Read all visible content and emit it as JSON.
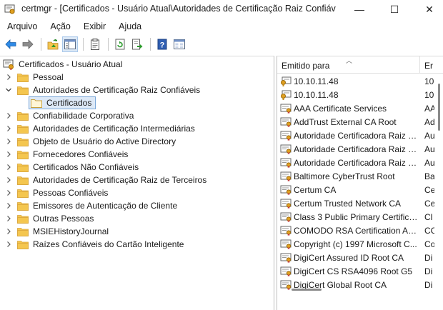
{
  "window": {
    "title": "certmgr - [Certificados - Usuário Atual\\Autoridades de Certificação Raiz Confiáveis\\C...",
    "min_glyph": "—",
    "max_glyph": "☐",
    "close_glyph": "✕"
  },
  "menu": [
    "Arquivo",
    "Ação",
    "Exibir",
    "Ajuda"
  ],
  "toolbar": {
    "icons": [
      "back-arrow-icon",
      "forward-arrow-icon",
      "up-folder-icon",
      "show-hide-tree-icon",
      "properties-icon",
      "refresh-icon",
      "export-list-icon",
      "help-icon",
      "help-topics-icon"
    ]
  },
  "tree": {
    "root": "Certificados - Usuário Atual",
    "items": [
      {
        "label": "Pessoal",
        "expanded": false
      },
      {
        "label": "Autoridades de Certificação Raiz Confiáveis",
        "expanded": true
      },
      {
        "label": "Confiabilidade Corporativa",
        "expanded": false
      },
      {
        "label": "Autoridades de Certificação Intermediárias",
        "expanded": false
      },
      {
        "label": "Objeto de Usuário do Active Directory",
        "expanded": false
      },
      {
        "label": "Fornecedores Confiáveis",
        "expanded": false
      },
      {
        "label": "Certificados Não Confiáveis",
        "expanded": false
      },
      {
        "label": "Autoridades de Certificação Raiz de Terceiros",
        "expanded": false
      },
      {
        "label": "Pessoas Confiáveis",
        "expanded": false
      },
      {
        "label": "Emissores de Autenticação de Cliente",
        "expanded": false
      },
      {
        "label": "Outras Pessoas",
        "expanded": false
      },
      {
        "label": "MSIEHistoryJournal",
        "expanded": false
      },
      {
        "label": "Raízes Confiáveis do Cartão Inteligente",
        "expanded": false
      }
    ],
    "selected_child": "Certificados"
  },
  "list": {
    "columns": [
      "Emitido para",
      "Er"
    ],
    "rows": [
      {
        "name": "10.10.11.48",
        "issuer": "10",
        "icon": "cert-key-icon"
      },
      {
        "name": "10.10.11.48",
        "issuer": "10",
        "icon": "cert-key-icon"
      },
      {
        "name": "AAA Certificate Services",
        "issuer": "AA",
        "icon": "cert-icon"
      },
      {
        "name": "AddTrust External CA Root",
        "issuer": "Ad",
        "icon": "cert-icon"
      },
      {
        "name": "Autoridade Certificadora Raiz B...",
        "issuer": "Au",
        "icon": "cert-icon"
      },
      {
        "name": "Autoridade Certificadora Raiz B...",
        "issuer": "Au",
        "icon": "cert-icon"
      },
      {
        "name": "Autoridade Certificadora Raiz B...",
        "issuer": "Au",
        "icon": "cert-icon"
      },
      {
        "name": "Baltimore CyberTrust Root",
        "issuer": "Ba",
        "icon": "cert-icon"
      },
      {
        "name": "Certum CA",
        "issuer": "Ce",
        "icon": "cert-icon"
      },
      {
        "name": "Certum Trusted Network CA",
        "issuer": "Ce",
        "icon": "cert-icon"
      },
      {
        "name": "Class 3 Public Primary Certificat...",
        "issuer": "Cl",
        "icon": "cert-icon"
      },
      {
        "name": "COMODO RSA Certification Au...",
        "issuer": "CC",
        "icon": "cert-icon"
      },
      {
        "name": "Copyright (c) 1997 Microsoft C...",
        "issuer": "Co",
        "icon": "cert-icon"
      },
      {
        "name": "DigiCert Assured ID Root CA",
        "issuer": "Di",
        "icon": "cert-icon"
      },
      {
        "name": "DigiCert CS RSA4096 Root G5",
        "issuer": "Di",
        "icon": "cert-icon"
      },
      {
        "name": "DigiCert Global Root CA",
        "issuer": "Di",
        "icon": "cert-icon"
      }
    ]
  },
  "colors": {
    "folder": "#f4c64f",
    "folder_dark": "#d9a43a",
    "selection_bg": "#dde9f7",
    "selection_border": "#7aa7d8",
    "help_blue": "#2f5fb3",
    "arrow_blue": "#2e8ae6"
  }
}
